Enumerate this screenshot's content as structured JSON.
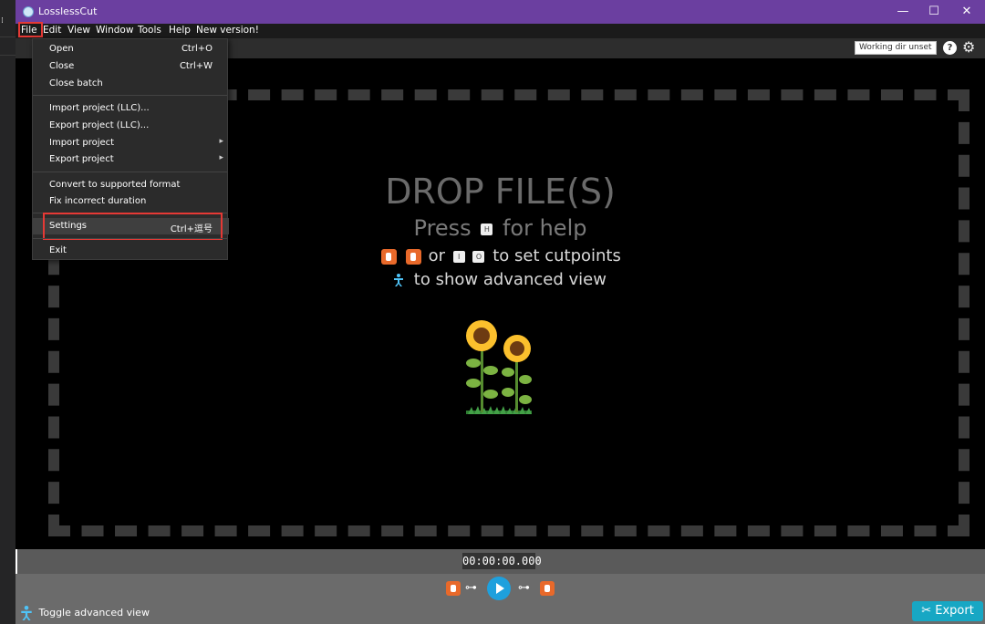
{
  "app": {
    "title": "LosslessCut"
  },
  "window_controls": {
    "minimize": "—",
    "maximize": "☐",
    "close": "✕"
  },
  "menubar": [
    {
      "label": "File"
    },
    {
      "label": "Edit"
    },
    {
      "label": "View"
    },
    {
      "label": "Window"
    },
    {
      "label": "Tools"
    },
    {
      "label": "Help"
    },
    {
      "label": "New version!"
    }
  ],
  "toolbar": {
    "working_dir": "Working dir unset",
    "help": "?"
  },
  "file_menu": {
    "open": {
      "label": "Open",
      "shortcut": "Ctrl+O"
    },
    "close": {
      "label": "Close",
      "shortcut": "Ctrl+W"
    },
    "close_batch": {
      "label": "Close batch"
    },
    "import_llc": {
      "label": "Import project (LLC)..."
    },
    "export_llc": {
      "label": "Export project (LLC)..."
    },
    "import_project": {
      "label": "Import project"
    },
    "export_project": {
      "label": "Export project"
    },
    "convert": {
      "label": "Convert to supported format"
    },
    "fix_duration": {
      "label": "Fix incorrect duration"
    },
    "settings": {
      "label": "Settings",
      "shortcut": "Ctrl+逗号"
    },
    "exit": {
      "label": "Exit"
    }
  },
  "dropzone": {
    "title": "DROP FILE(S)",
    "press": "Press",
    "help_key": "H",
    "for_help": "for help",
    "or": "or",
    "key_i": "I",
    "key_o": "O",
    "set_cutpoints": "to set cutpoints",
    "show_advanced": "to show advanced view"
  },
  "timeline": {
    "timecode": "00:00:00.000"
  },
  "bottom": {
    "toggle_advanced": "Toggle advanced view",
    "export": "Export"
  },
  "colors": {
    "titlebar": "#6b3fa0",
    "accent": "#17a7c4",
    "cutpoint": "#e8692a",
    "highlight": "#e53935"
  }
}
